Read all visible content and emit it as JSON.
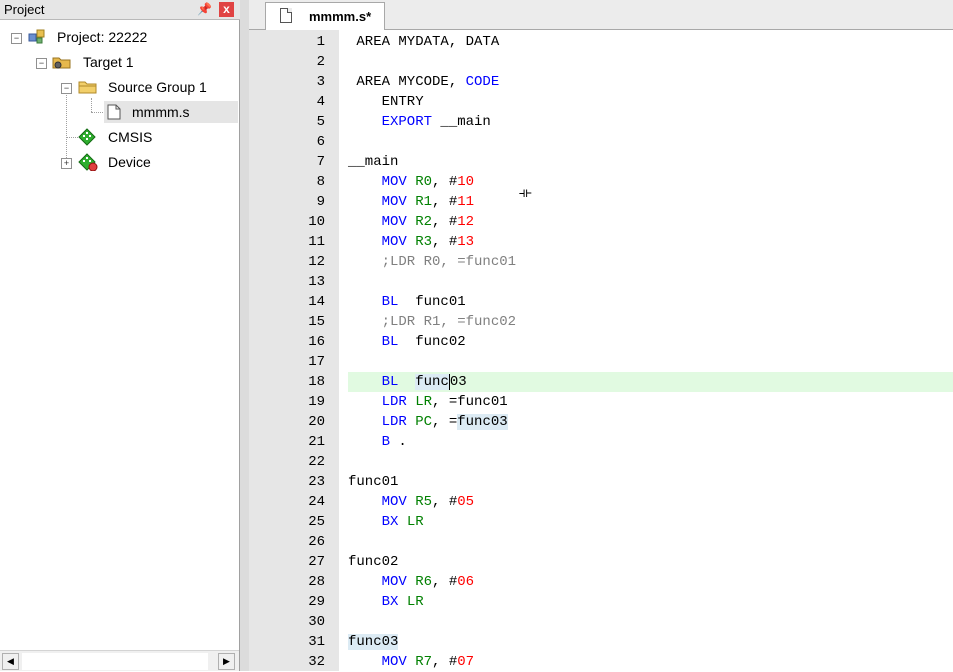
{
  "project_pane": {
    "title": "Project",
    "pin_glyph": "Ԅ",
    "close_glyph": "x",
    "tree": [
      {
        "label": "Project: 22222",
        "icon": "project-icon",
        "expander": "−"
      },
      {
        "label": "Target 1",
        "icon": "target-icon",
        "expander": "−"
      },
      {
        "label": "Source Group 1",
        "icon": "folder-icon",
        "expander": "−"
      },
      {
        "label": "mmmm.s",
        "icon": "file-icon"
      },
      {
        "label": "CMSIS",
        "icon": "cmsis-icon"
      },
      {
        "label": "Device",
        "icon": "device-icon",
        "expander": "+"
      }
    ],
    "scroll_left": "◀",
    "scroll_right": "▶"
  },
  "editor": {
    "tab_label": "mmmm.s*",
    "current_line": 18,
    "line_numbers": [
      "1",
      "2",
      "3",
      "4",
      "5",
      "6",
      "7",
      "8",
      "9",
      "10",
      "11",
      "12",
      "13",
      "14",
      "15",
      "16",
      "17",
      "18",
      "19",
      "20",
      "21",
      "22",
      "23",
      "24",
      "25",
      "26",
      "27",
      "28",
      "29",
      "30",
      "31",
      "32"
    ],
    "lines": [
      [
        {
          "t": " AREA MYDATA, DATA",
          "c": "lbl"
        }
      ],
      [],
      [
        {
          "t": " AREA MYCODE, ",
          "c": "lbl"
        },
        {
          "t": "CODE",
          "c": "kw"
        }
      ],
      [
        {
          "t": "    ENTRY",
          "c": "lbl"
        }
      ],
      [
        {
          "t": "    EXPORT",
          "c": "kw"
        },
        {
          "t": " __main",
          "c": "lbl"
        }
      ],
      [],
      [
        {
          "t": "__main",
          "c": "lbl"
        }
      ],
      [
        {
          "t": "    MOV ",
          "c": "kw"
        },
        {
          "t": "R0",
          "c": "reg"
        },
        {
          "t": ", #",
          "c": "lbl"
        },
        {
          "t": "10",
          "c": "num"
        }
      ],
      [
        {
          "t": "    MOV ",
          "c": "kw"
        },
        {
          "t": "R1",
          "c": "reg"
        },
        {
          "t": ", #",
          "c": "lbl"
        },
        {
          "t": "11",
          "c": "num"
        }
      ],
      [
        {
          "t": "    MOV ",
          "c": "kw"
        },
        {
          "t": "R2",
          "c": "reg"
        },
        {
          "t": ", #",
          "c": "lbl"
        },
        {
          "t": "12",
          "c": "num"
        }
      ],
      [
        {
          "t": "    MOV ",
          "c": "kw"
        },
        {
          "t": "R3",
          "c": "reg"
        },
        {
          "t": ", #",
          "c": "lbl"
        },
        {
          "t": "13",
          "c": "num"
        }
      ],
      [
        {
          "t": "    ;LDR R0, =func01",
          "c": "cmt"
        }
      ],
      [],
      [
        {
          "t": "    BL",
          "c": "kw"
        },
        {
          "t": "  func01",
          "c": "lbl"
        }
      ],
      [
        {
          "t": "    ;LDR R1, =func02",
          "c": "cmt"
        }
      ],
      [
        {
          "t": "    BL",
          "c": "kw"
        },
        {
          "t": "  func02",
          "c": "lbl"
        }
      ],
      [],
      [
        {
          "t": "    BL",
          "c": "kw"
        },
        {
          "t": "  ",
          "c": "lbl"
        },
        {
          "t": "func",
          "c": "lbl hl"
        },
        {
          "t": "03",
          "c": "lbl caret"
        }
      ],
      [
        {
          "t": "    LDR ",
          "c": "kw"
        },
        {
          "t": "LR",
          "c": "reg"
        },
        {
          "t": ", =func01",
          "c": "lbl"
        }
      ],
      [
        {
          "t": "    LDR ",
          "c": "kw"
        },
        {
          "t": "PC",
          "c": "reg"
        },
        {
          "t": ", =",
          "c": "lbl"
        },
        {
          "t": "func03",
          "c": "lbl hl"
        }
      ],
      [
        {
          "t": "    B",
          "c": "kw"
        },
        {
          "t": " .",
          "c": "lbl"
        }
      ],
      [],
      [
        {
          "t": "func01",
          "c": "lbl"
        }
      ],
      [
        {
          "t": "    MOV ",
          "c": "kw"
        },
        {
          "t": "R5",
          "c": "reg"
        },
        {
          "t": ", #",
          "c": "lbl"
        },
        {
          "t": "05",
          "c": "num"
        }
      ],
      [
        {
          "t": "    BX ",
          "c": "kw"
        },
        {
          "t": "LR",
          "c": "reg"
        }
      ],
      [],
      [
        {
          "t": "func02",
          "c": "lbl"
        }
      ],
      [
        {
          "t": "    MOV ",
          "c": "kw"
        },
        {
          "t": "R6",
          "c": "reg"
        },
        {
          "t": ", #",
          "c": "lbl"
        },
        {
          "t": "06",
          "c": "num"
        }
      ],
      [
        {
          "t": "    BX ",
          "c": "kw"
        },
        {
          "t": "LR",
          "c": "reg"
        }
      ],
      [],
      [
        {
          "t": "func03",
          "c": "lbl hl"
        }
      ],
      [
        {
          "t": "    MOV ",
          "c": "kw"
        },
        {
          "t": "R7",
          "c": "reg"
        },
        {
          "t": ", #",
          "c": "lbl"
        },
        {
          "t": "07",
          "c": "num"
        }
      ]
    ],
    "mouse_cursor_glyph": "⟛"
  },
  "colors": {
    "keyword": "#0000ff",
    "register": "#008000",
    "number": "#ff0000",
    "comment": "#808080",
    "current_line": "#e1fae1",
    "word_highlight": "#dcebf4"
  }
}
